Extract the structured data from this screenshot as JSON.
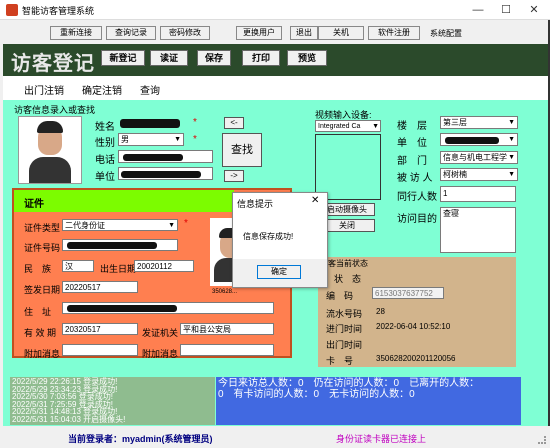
{
  "window": {
    "title": "智能访客管理系统",
    "minimize": "—",
    "maximize": "☐",
    "close": "✕"
  },
  "menu": {
    "reconnect": "重新连接",
    "query_records": "查询记录",
    "change_password": "密码修改",
    "change_user": "更换用户",
    "exit": "退出",
    "shutdown": "关机",
    "software_register": "软件注册",
    "system_config": "系统配置"
  },
  "header": {
    "title": "访客登记",
    "new_register": "新登记",
    "verify": "读证",
    "save": "保存",
    "print": "打印",
    "preview": "预览"
  },
  "nav": {
    "logout": "出门注销",
    "confirm_logout": "确定注销",
    "query": "查询"
  },
  "visitor_info": {
    "section_label": "访客信息录入或查找",
    "name_label": "姓名",
    "gender_label": "性别",
    "gender_value": "男",
    "phone_label": "电话",
    "company_label": "单位",
    "star": "*",
    "btn_left": "<-",
    "btn_find": "查找",
    "btn_right": "->"
  },
  "video": {
    "label": "视频输入设备:",
    "device": "Integrated Ca",
    "start_camera": "启动摄像头",
    "close": "关闭"
  },
  "host": {
    "floor_label": "楼　层",
    "floor_value": "第三层",
    "unit_label": "单　位",
    "dept_label": "部　门",
    "dept_value": "信息与机电工程学",
    "visitee_label": "被 访 人",
    "visitee_value": "柯树楠",
    "companions_label": "同行人数",
    "companions_value": "1",
    "purpose_label": "访问目的",
    "purpose_value": "查寝"
  },
  "certificate": {
    "header": "证件",
    "type_label": "证件类型",
    "type_value": "二代身份证",
    "number_label": "证件号码",
    "ethnicity_label": "民　族",
    "ethnicity_value": "汉",
    "birth_label": "出生日期",
    "birth_value": "20020112",
    "issue_label": "签发日期",
    "issue_value": "20220517",
    "address_label": "住　址",
    "valid_label": "有 效 期",
    "valid_value": "20320517",
    "authority_label": "发证机关",
    "authority_value": "平和县公安局",
    "extra1_label": "附加消息",
    "extra2_label": "附加消息",
    "photo_caption": "350628..."
  },
  "visitor_status": {
    "header": "访客当前状态",
    "state_label": "状　态",
    "code_label": "编　码",
    "code_value": "6153037637752",
    "serial_label": "流水号码",
    "serial_value": "28",
    "entry_label": "进门时间",
    "entry_value": "2022-06-04 10:52:10",
    "exit_label": "出门时间",
    "card_label": "卡　号",
    "card_value": "350628200201120056"
  },
  "log": [
    "2022/5/29 22:26:15 登录成功!",
    "2022/5/29 23:34:23 登录成功!",
    "2022/5/30 7:03:56 登录成功!",
    "2022/5/31 7:25:59 登录成功!",
    "2022/5/31 14:48:13 登录成功!",
    "2022/5/31 15:04:03 开启摄像头!"
  ],
  "stats": {
    "line1": "今日来访总人数：0　仍在访问的人数：0　已离开的人数：",
    "line2": "0　有卡访问的人数：0　无卡访问的人数：0"
  },
  "status_bar": {
    "current_user": "当前登录者：myadmin(系统管理员)",
    "reader_status": "身份证读卡器已连接上"
  },
  "dialog": {
    "title": "信息提示",
    "close": "✕",
    "message": "信息保存成功!",
    "ok": "确定"
  },
  "colors": {
    "main_bg": "#7fffd4",
    "cert_bg": "#ff7f50",
    "cert_header": "#7cfc00",
    "stats_bg": "#4169e1",
    "log_bg": "#8fbc8f",
    "status_panel": "#d2b48c",
    "header_bg": "#2b4a2b"
  }
}
